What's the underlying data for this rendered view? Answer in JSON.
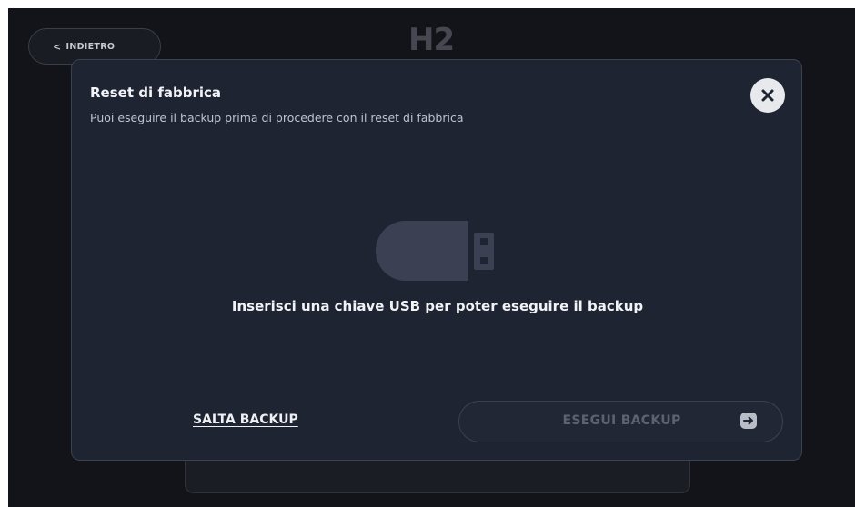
{
  "background": {
    "back_button": {
      "label": "INDIETRO",
      "icon": "chevron-left-icon"
    },
    "logo": {
      "text": "H2"
    }
  },
  "modal": {
    "title": "Reset di fabbrica",
    "subtitle": "Puoi eseguire il backup prima di procedere con il reset di fabbrica",
    "close_icon": "close-icon",
    "usb_icon": "usb-drive-icon",
    "message": "Inserisci una chiave USB per poter eseguire il backup",
    "skip_label": "SALTA BACKUP",
    "primary_label": "ESEGUI BACKUP",
    "primary_icon": "arrow-right-icon",
    "primary_enabled": false
  },
  "colors": {
    "screen_bg": "#131419",
    "modal_bg": "#1f2433",
    "text_primary": "#f2f3f6",
    "text_secondary": "#bfc3cd",
    "disabled_text": "#5c6272",
    "icon_fill": "#3b4152"
  }
}
